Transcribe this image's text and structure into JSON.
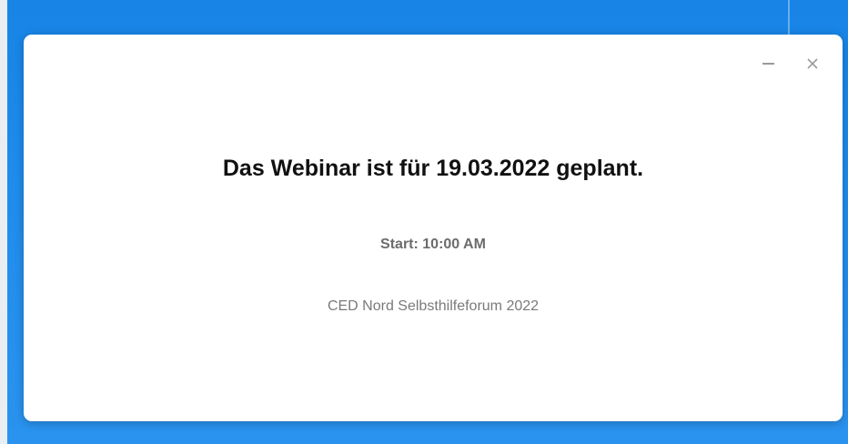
{
  "dialog": {
    "heading": "Das Webinar ist für 19.03.2022 geplant.",
    "start_time": "Start: 10:00 AM",
    "event_name": "CED Nord Selbsthilfeforum 2022"
  },
  "window_controls": {
    "minimize_icon": "minimize-icon",
    "close_icon": "close-icon"
  },
  "colors": {
    "desktop_background": "#1f8cec",
    "dialog_background": "#ffffff",
    "heading_text": "#111111",
    "secondary_text": "#6c6c6c"
  }
}
